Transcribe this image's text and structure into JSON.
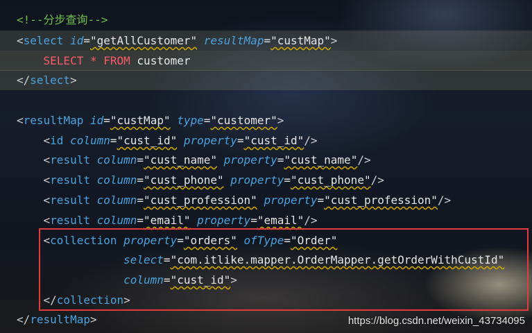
{
  "lines": [
    {
      "text": "<!--分步查询-->"
    },
    {
      "text": "<select id=\"getAllCustomer\" resultMap=\"custMap\">"
    },
    {
      "text": "    SELECT * FROM customer"
    },
    {
      "text": "</select>"
    },
    {
      "text": ""
    },
    {
      "text": "<resultMap id=\"custMap\" type=\"customer\">"
    },
    {
      "text": "    <id column=\"cust_id\" property=\"cust_id\"/>"
    },
    {
      "text": "    <result column=\"cust_name\" property=\"cust_name\"/>"
    },
    {
      "text": "    <result column=\"cust_phone\" property=\"cust_phone\"/>"
    },
    {
      "text": "    <result column=\"cust_profession\" property=\"cust_profession\"/>"
    },
    {
      "text": "    <result column=\"email\" property=\"email\"/>"
    },
    {
      "text": "    <collection property=\"orders\" ofType=\"Order\""
    },
    {
      "text": "                select=\"com.itlike.mapper.OrderMapper.getOrderWithCustId\""
    },
    {
      "text": "                column=\"cust_id\">"
    },
    {
      "text": "    </collection>"
    },
    {
      "text": "</resultMap>"
    }
  ],
  "watermark": "https://blog.csdn.net/weixin_43734095",
  "colors": {
    "tag": "#4aa3df",
    "comment": "#6fbf4f",
    "keyword": "#ff5a6a",
    "highlight_box": "#e23b3b"
  }
}
